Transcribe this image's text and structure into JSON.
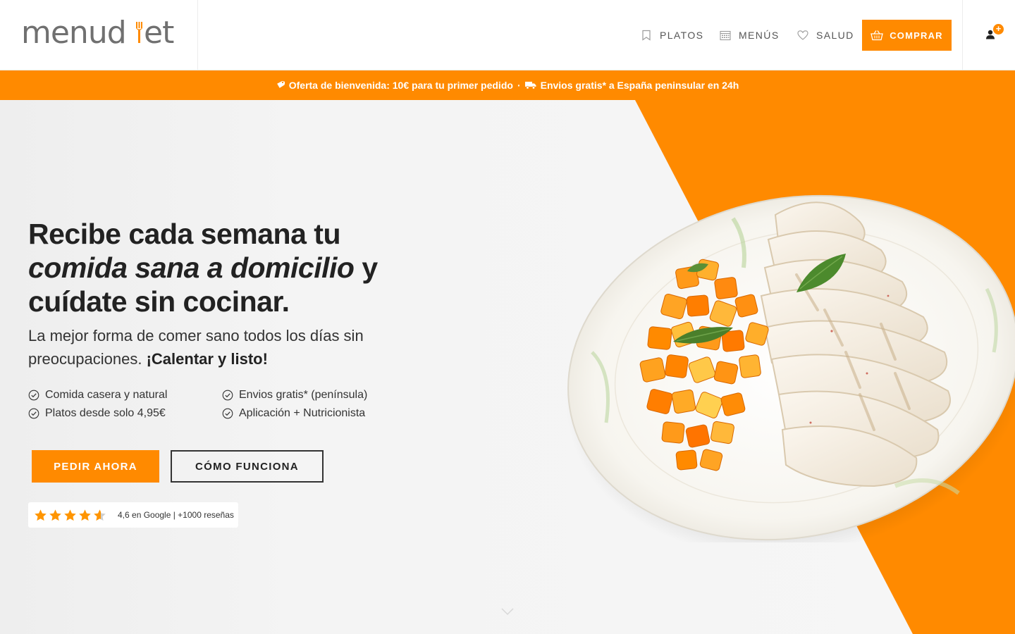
{
  "header": {
    "logo": "menudiet",
    "nav": [
      {
        "label": "PLATOS",
        "icon": "bookmark-icon"
      },
      {
        "label": "MENÚS",
        "icon": "calendar-icon"
      },
      {
        "label": "SALUD",
        "icon": "heart-icon"
      }
    ],
    "cta": {
      "label": "COMPRAR",
      "icon": "basket-icon"
    },
    "account": {
      "icon": "user-icon",
      "badge": "+"
    }
  },
  "promo": {
    "part1": "Oferta de bienvenida: 10€ para tu primer pedido",
    "separator": "·",
    "part2": "Envios gratis* a España peninsular en 24h"
  },
  "hero": {
    "title_line1": "Recibe cada semana tu",
    "title_emph": "comida sana a domicilio",
    "title_after_emph": "y",
    "title_line3": "cuídate sin cocinar.",
    "subtitle": "La mejor forma de comer sano todos los días sin preocupaciones.",
    "subtitle_bold": "¡Calentar y listo!",
    "features": [
      "Comida casera y natural",
      "Envios gratis* (península)",
      "Platos desde solo 4,95€",
      "Aplicación + Nutricionista"
    ],
    "primary_button": "PEDIR AHORA",
    "secondary_button": "CÓMO FUNCIONA",
    "rating": {
      "stars": 4.6,
      "text": "4,6 en Google | +1000 reseñas"
    }
  },
  "colors": {
    "accent": "#ff8a00",
    "text": "#222222",
    "nav_text": "#555555"
  }
}
